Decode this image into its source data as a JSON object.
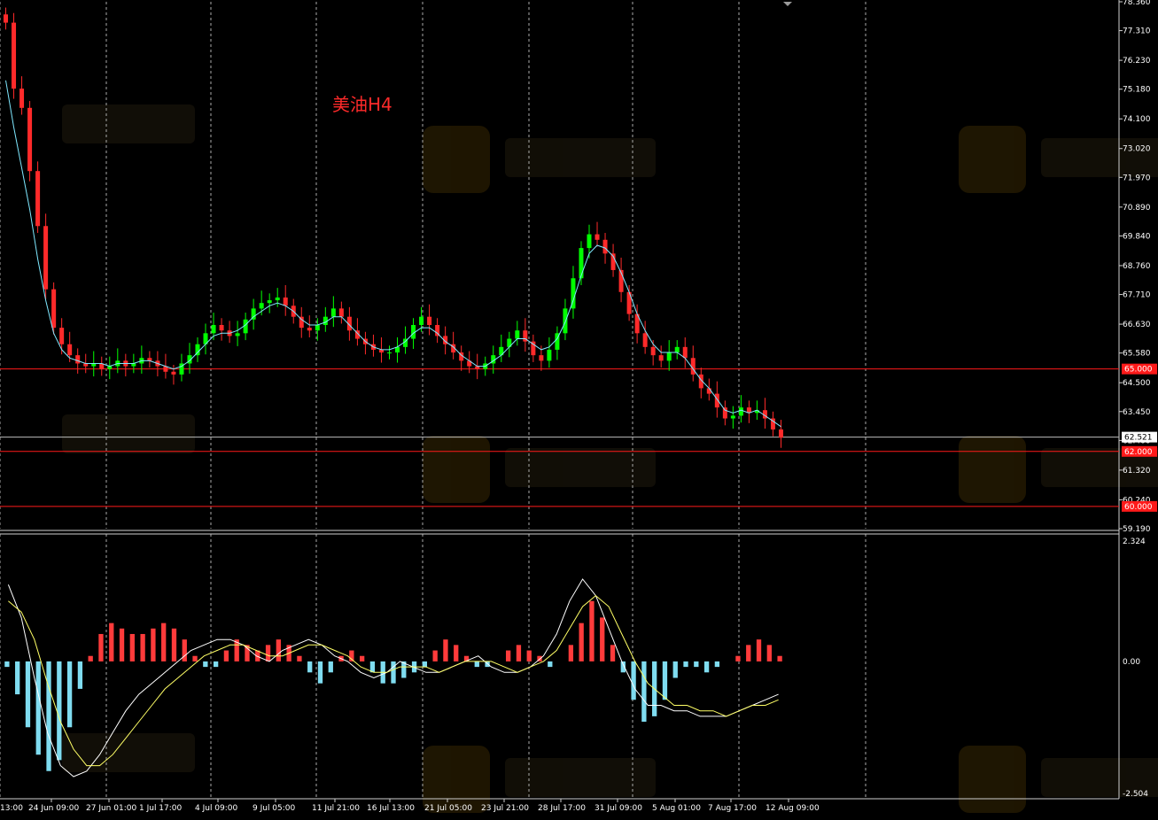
{
  "chart_data": [
    {
      "type": "candlestick",
      "title": "美油H4",
      "timeframe": "H4",
      "y_axis_ticks": [
        "78.360",
        "77.310",
        "76.230",
        "75.180",
        "74.100",
        "73.020",
        "71.970",
        "70.890",
        "69.840",
        "68.760",
        "67.710",
        "66.630",
        "65.580",
        "64.500",
        "63.450",
        "62.400",
        "61.320",
        "60.240",
        "59.190"
      ],
      "ylim": [
        59.19,
        78.36
      ],
      "x_axis_ticks": [
        "13:00",
        "24 Jun 09:00",
        "27 Jun 01:00",
        "1 Jul 17:00",
        "4 Jul 09:00",
        "9 Jul 05:00",
        "11 Jul 21:00",
        "16 Jul 13:00",
        "21 Jul 05:00",
        "23 Jul 21:00",
        "28 Jul 17:00",
        "31 Jul 09:00",
        "5 Aug 01:00",
        "7 Aug 17:00",
        "12 Aug 09:00"
      ],
      "current_price": "62.521",
      "horizontal_levels": [
        {
          "label": "65.000",
          "value": 65.0
        },
        {
          "label": "62.000",
          "value": 62.0
        },
        {
          "label": "60.000",
          "value": 60.0
        }
      ],
      "price_path": [
        77.6,
        75.2,
        74.5,
        72.2,
        70.2,
        67.9,
        66.5,
        65.9,
        65.5,
        65.2,
        65.1,
        65.2,
        65.0,
        65.1,
        65.3,
        65.1,
        65.2,
        65.4,
        65.3,
        65.1,
        64.9,
        64.8,
        65.2,
        65.5,
        65.9,
        66.3,
        66.6,
        66.4,
        66.2,
        66.3,
        66.8,
        67.2,
        67.4,
        67.5,
        67.6,
        67.3,
        66.9,
        66.5,
        66.4,
        66.6,
        66.9,
        67.2,
        66.9,
        66.4,
        66.1,
        65.9,
        65.7,
        65.6,
        65.6,
        65.8,
        66.1,
        66.6,
        66.9,
        66.6,
        66.2,
        65.9,
        65.6,
        65.3,
        65.1,
        65.0,
        65.2,
        65.5,
        65.8,
        66.1,
        66.4,
        66.0,
        65.5,
        65.3,
        65.7,
        66.3,
        67.2,
        68.3,
        69.4,
        69.9,
        69.7,
        69.2,
        68.6,
        67.8,
        67.0,
        66.3,
        65.8,
        65.5,
        65.3,
        65.6,
        65.8,
        65.4,
        64.8,
        64.3,
        64.1,
        63.6,
        63.2,
        63.3,
        63.6,
        63.4,
        63.5,
        63.2,
        62.8,
        62.5
      ],
      "ma_path": [
        75.5,
        73.8,
        72.3,
        70.8,
        69.0,
        67.5,
        66.3,
        65.7,
        65.4,
        65.3,
        65.2,
        65.2,
        65.2,
        65.1,
        65.2,
        65.2,
        65.2,
        65.3,
        65.3,
        65.2,
        65.1,
        65.0,
        65.1,
        65.3,
        65.6,
        65.9,
        66.2,
        66.3,
        66.3,
        66.4,
        66.6,
        66.9,
        67.1,
        67.3,
        67.4,
        67.3,
        67.1,
        66.8,
        66.6,
        66.6,
        66.7,
        66.9,
        66.9,
        66.6,
        66.3,
        66.0,
        65.8,
        65.7,
        65.7,
        65.8,
        66.0,
        66.3,
        66.5,
        66.5,
        66.3,
        66.0,
        65.8,
        65.5,
        65.3,
        65.1,
        65.1,
        65.3,
        65.5,
        65.8,
        66.1,
        66.1,
        65.9,
        65.7,
        65.8,
        66.1,
        66.7,
        67.5,
        68.4,
        69.2,
        69.5,
        69.4,
        69.1,
        68.5,
        67.8,
        67.0,
        66.4,
        65.9,
        65.6,
        65.6,
        65.6,
        65.4,
        65.0,
        64.6,
        64.3,
        63.9,
        63.5,
        63.4,
        63.5,
        63.4,
        63.5,
        63.3,
        63.1,
        62.9
      ]
    },
    {
      "type": "macd",
      "y_axis_ticks": [
        "2.324",
        "0.00",
        "-2.504"
      ],
      "ylim": [
        -2.504,
        2.324
      ],
      "histogram": [
        -0.1,
        -0.6,
        -1.2,
        -1.7,
        -2.0,
        -1.8,
        -1.2,
        -0.5,
        0.1,
        0.5,
        0.7,
        0.6,
        0.5,
        0.5,
        0.6,
        0.7,
        0.6,
        0.4,
        0.1,
        -0.1,
        -0.1,
        0.2,
        0.4,
        0.3,
        0.2,
        0.3,
        0.4,
        0.3,
        0.1,
        -0.2,
        -0.4,
        -0.2,
        0.1,
        0.2,
        0.1,
        -0.2,
        -0.4,
        -0.4,
        -0.3,
        -0.2,
        -0.1,
        0.2,
        0.4,
        0.3,
        0.1,
        -0.1,
        -0.1,
        0.0,
        0.2,
        0.3,
        0.2,
        0.1,
        -0.1,
        0.0,
        0.3,
        0.7,
        1.1,
        0.8,
        0.3,
        -0.2,
        -0.7,
        -1.1,
        -1.0,
        -0.7,
        -0.3,
        -0.1,
        -0.1,
        -0.2,
        -0.1,
        0.0,
        0.1,
        0.3,
        0.4,
        0.3,
        0.1
      ],
      "macd_line": [
        1.4,
        0.8,
        -0.3,
        -1.3,
        -1.9,
        -2.1,
        -2.0,
        -1.7,
        -1.3,
        -0.9,
        -0.6,
        -0.4,
        -0.2,
        0.0,
        0.2,
        0.3,
        0.4,
        0.4,
        0.3,
        0.1,
        0.0,
        0.2,
        0.3,
        0.4,
        0.3,
        0.1,
        0.0,
        -0.2,
        -0.3,
        -0.2,
        0.0,
        -0.1,
        -0.2,
        -0.2,
        -0.1,
        0.0,
        0.1,
        -0.1,
        -0.2,
        -0.2,
        -0.1,
        0.1,
        0.5,
        1.1,
        1.5,
        1.2,
        0.6,
        0.0,
        -0.5,
        -0.8,
        -0.8,
        -0.9,
        -0.9,
        -1.0,
        -1.0,
        -1.0,
        -0.9,
        -0.8,
        -0.7,
        -0.6
      ],
      "signal_line": [
        1.1,
        0.9,
        0.4,
        -0.4,
        -1.1,
        -1.6,
        -1.9,
        -1.9,
        -1.7,
        -1.4,
        -1.1,
        -0.8,
        -0.5,
        -0.3,
        -0.1,
        0.1,
        0.2,
        0.3,
        0.3,
        0.2,
        0.1,
        0.1,
        0.2,
        0.3,
        0.3,
        0.2,
        0.1,
        -0.1,
        -0.2,
        -0.2,
        -0.1,
        -0.1,
        -0.1,
        -0.2,
        -0.1,
        0.0,
        0.0,
        0.0,
        -0.1,
        -0.2,
        -0.1,
        0.0,
        0.2,
        0.6,
        1.0,
        1.2,
        1.0,
        0.5,
        0.0,
        -0.4,
        -0.6,
        -0.8,
        -0.8,
        -0.9,
        -0.9,
        -1.0,
        -0.9,
        -0.8,
        -0.8,
        -0.7
      ]
    }
  ],
  "colors": {
    "background": "#000000",
    "grid": "#c8c8c8",
    "axis_text": "#ffffff",
    "bull": "#00ff00",
    "bear": "#ff2a2a",
    "ma": "#7fe8ff",
    "level_line": "#ff1a1a",
    "current_line": "#bcbcbc",
    "macd_positive": "#ff3b3b",
    "macd_negative": "#7fdcf0",
    "macd_line": "#ffffff",
    "signal_line": "#ffff66"
  }
}
